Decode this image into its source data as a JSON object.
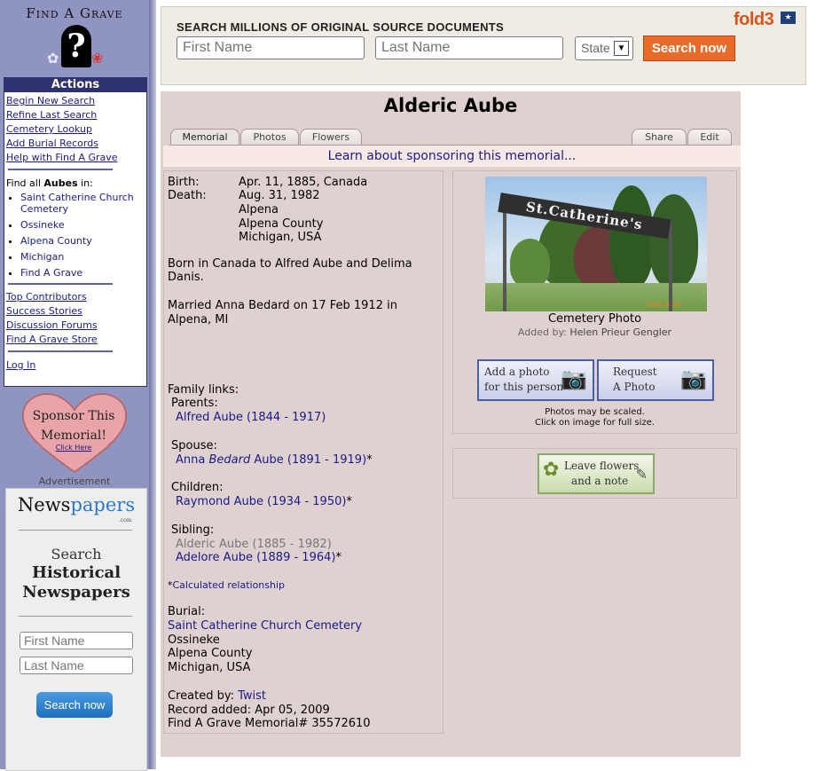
{
  "sidebar": {
    "logo_title": "Find A Grave",
    "actions_header": "Actions",
    "links": [
      "Begin New Search",
      "Refine Last Search",
      "Cemetery Lookup",
      "Add Burial Records",
      "Help with Find A Grave"
    ],
    "find_all_prefix": "Find all",
    "find_all_surname": "Aubes",
    "find_all_suffix": "in:",
    "places": [
      "Saint Catherine Church Cemetery",
      "Ossineke",
      "Alpena County",
      "Michigan",
      "Find A Grave"
    ],
    "community_links": [
      "Top Contributors",
      "Success Stories",
      "Discussion Forums",
      "Find A Grave Store"
    ],
    "login": "Log In",
    "sponsor_line1": "Sponsor This",
    "sponsor_line2": "Memorial!",
    "sponsor_click": "Click Here",
    "advertisement": "Advertisement"
  },
  "newspapers_ad": {
    "brand_main": "News",
    "brand_accent": "papers",
    "brand_tld": ".com",
    "line1": "Search",
    "line2": "Historical",
    "line3": "Newspapers",
    "first_placeholder": "First Name",
    "last_placeholder": "Last Name",
    "button": "Search now"
  },
  "banner": {
    "headline": "SEARCH MILLIONS OF ORIGINAL SOURCE DOCUMENTS",
    "brand": "fold3",
    "first_placeholder": "First Name",
    "last_placeholder": "Last Name",
    "state_label": "State",
    "button": "Search now",
    "colors": {
      "button": "#e96b2a",
      "brand": "#d9531e"
    }
  },
  "memorial": {
    "name": "Alderic Aube",
    "tabs": [
      "Memorial",
      "Photos",
      "Flowers"
    ],
    "right_tabs": [
      "Share",
      "Edit"
    ],
    "sponsor_link": "Learn about sponsoring this memorial...",
    "birth_label": "Birth:",
    "birth_value": "Apr. 11, 1885, Canada",
    "death_label": "Death:",
    "death_date": "Aug. 31, 1982",
    "death_place": [
      "Alpena",
      "Alpena County",
      "Michigan, USA"
    ],
    "bio1_line1": "Born in Canada to Alfred Aube and Delima",
    "bio1_line2": "Danis.",
    "bio2_line1": "Married Anna Bedard on 17 Feb 1912 in",
    "bio2_line2": "Alpena, MI",
    "family_label": "Family links:",
    "parents_label": "Parents:",
    "parent1": "Alfred Aube (1844 - 1917)",
    "spouse_label": "Spouse:",
    "spouse_first": "Anna",
    "spouse_maiden": "Bedard",
    "spouse_rest": "Aube (1891 - 1919)",
    "asterisk": "*",
    "children_label": "Children:",
    "child1": "Raymond Aube (1934 - 1950)",
    "sibling_label": "Sibling:",
    "sibling_self": "Alderic Aube (1885 - 1982)",
    "sibling1": "Adelore Aube (1889 - 1964)",
    "calc_link": "Calculated relationship",
    "burial_label": "Burial:",
    "burial_cemetery": "Saint Catherine Church Cemetery",
    "burial_place": [
      "Ossineke",
      "Alpena County",
      "Michigan, USA"
    ],
    "created_label": "Created by:",
    "created_by": "Twist",
    "record_added": "Record added: Apr 05, 2009",
    "memorial_id": "Find A Grave Memorial# 35572610"
  },
  "photo": {
    "sign_text": "St.Catherine's",
    "date_stamp": "2005 8 20",
    "caption": "Cemetery Photo",
    "added_by_label": "Added by:",
    "added_by": "Helen Prieur Gengler",
    "add_photo_line1": "Add a photo",
    "add_photo_line2": "for this person",
    "request_line1": "Request",
    "request_line2": "A Photo",
    "note_line1": "Photos may be scaled.",
    "note_line2": "Click on image for full size.",
    "flowers_line1": "Leave flowers",
    "flowers_line2": "and a note"
  }
}
